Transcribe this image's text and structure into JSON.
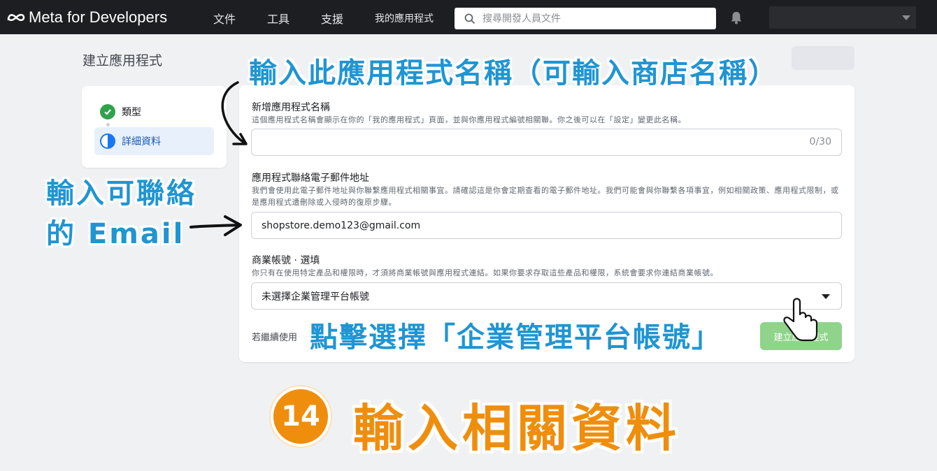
{
  "topbar": {
    "logo_text": "Meta for Developers",
    "nav": [
      "文件",
      "工具",
      "支援",
      "我的應用程式"
    ],
    "search_placeholder": "搜尋開發人員文件"
  },
  "page_title": "建立應用程式",
  "steps": [
    {
      "label": "類型",
      "status": "done"
    },
    {
      "label": "詳細資料",
      "status": "current"
    }
  ],
  "form": {
    "name_label": "新增應用程式名稱",
    "name_desc": "這個應用程式名稱會顯示在你的「我的應用程式」頁面，並與你應用程式編號相關聯。你之後可以在「設定」變更此名稱。",
    "name_value": "",
    "name_counter": "0/30",
    "email_label": "應用程式聯絡電子郵件地址",
    "email_desc": "我們會使用此電子郵件地址與你聯繫應用程式相關事宜。請確認這是你會定期查看的電子郵件地址。我們可能會與你聯繫各項事宜，例如相關政策、應用程式限制，或是應用程式遭刪除或入侵時的復原步驟。",
    "email_value": "shopstore.demo123@gmail.com",
    "business_label": "商業帳號 · 選填",
    "business_desc": "你只有在使用特定產品和權限時，才須將商業帳號與應用程式連結。如果你要求存取這些產品和權限，系統會要求你連結商業帳號。",
    "business_selected": "未選擇企業管理平台帳號",
    "footer_text": "若繼續使用",
    "create_button": "建立應用程式"
  },
  "annotations": {
    "top": "輸入此應用程式名稱（可輸入商店名稱）",
    "email_line1": "輸入可聯絡",
    "email_line2": "的 Email",
    "bottom": "點擊選擇「企業管理平台帳號」",
    "step_number": "14",
    "title": "輸入相關資料"
  },
  "colors": {
    "annotation_blue": "#1f95d2",
    "annotation_orange": "#ef8e0c",
    "topbar_bg": "#1c1e21",
    "success_green": "#31a24c",
    "primary_blue": "#1877f2"
  }
}
